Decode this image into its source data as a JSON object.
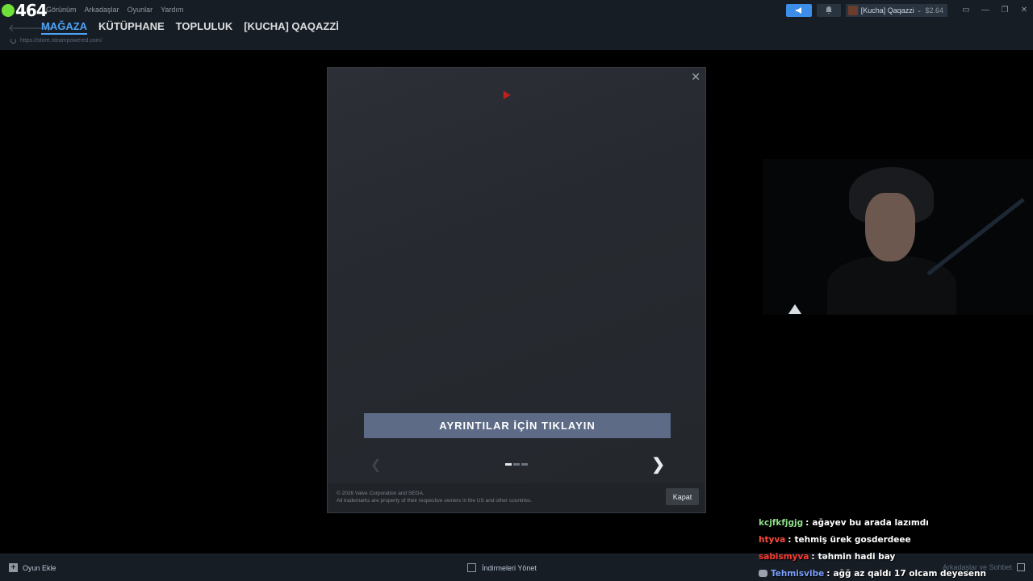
{
  "stream": {
    "viewer_count": "464"
  },
  "menu": {
    "items": [
      "Görünüm",
      "Arkadaşlar",
      "Oyunlar",
      "Yardım"
    ]
  },
  "account": {
    "name": "[Kucha] Qaqazzi",
    "wallet": "$2.64"
  },
  "nav": {
    "tabs": [
      "MAĞAZA",
      "KÜTÜPHANE",
      "TOPLULUK",
      "[KUCHA] QAQAZZİ"
    ],
    "url": "https://store.steampowered.com/"
  },
  "modal": {
    "details_button": "AYRINTILAR İÇİN TIKLAYIN",
    "copyright_line1": "© 2026 Valve Corporation and SEGA.",
    "copyright_line2": "All trademarks are property of their respective owners in the US and other countries.",
    "close_button": "Kapat",
    "carousel": {
      "pages": 3,
      "current": 1
    }
  },
  "bottom_bar": {
    "add_game": "Oyun Ekle",
    "downloads": "İndirmeleri Yönet",
    "friends_chat": "Arkadaşlar ve Sohbet"
  },
  "chat": [
    {
      "user": "kcjfkfjgjg",
      "color": "#8fe08a",
      "message": "ağayev bu arada lazımdı",
      "icon": ""
    },
    {
      "user": "htyva",
      "color": "#ff4a3d",
      "message": "tehmiş ürek gosderdeee",
      "icon": ""
    },
    {
      "user": "sabismyva",
      "color": "#ff3a2e",
      "message": "təhmin hadi bay",
      "icon": ""
    },
    {
      "user": "Tehmisvibe",
      "color": "#7aa0ff",
      "message": "ağğ az qaldı 17 olcam deyesenn",
      "icon": "gamepad-icon"
    }
  ],
  "colors": {
    "accent": "#4fa3f7",
    "details_button": "#5d6b86",
    "viewer_dot": "#6fe03a"
  }
}
